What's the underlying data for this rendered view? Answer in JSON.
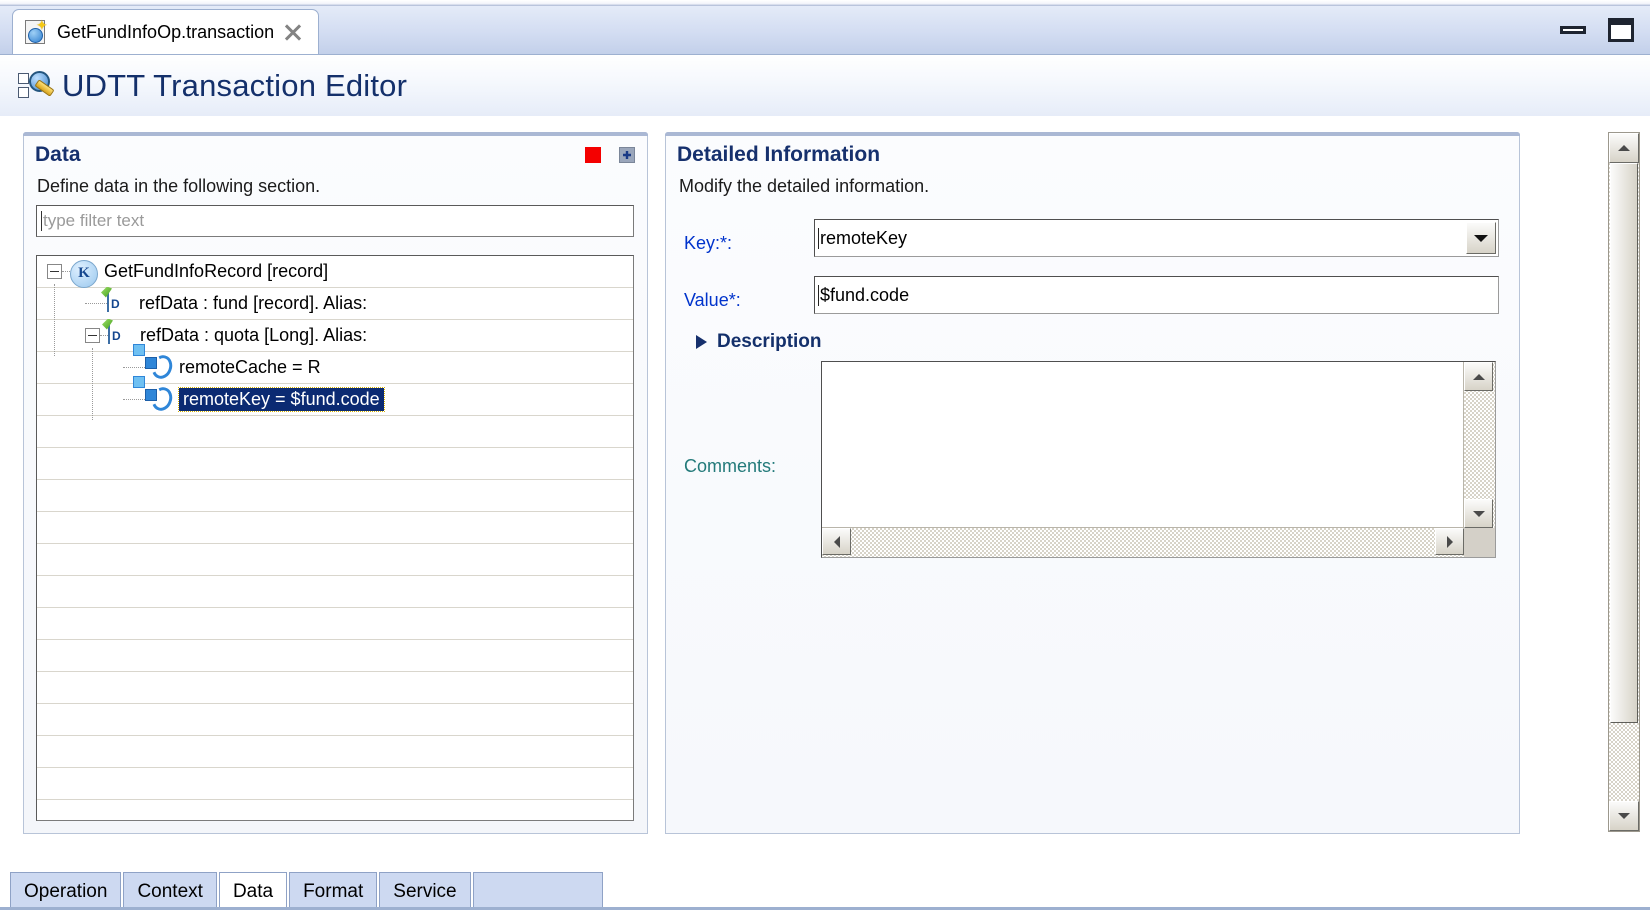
{
  "window": {
    "tab_title": "GetFundInfoOp.transaction",
    "tab_icon": "transaction-file-icon",
    "close_icon": "close-icon",
    "minimize_icon": "minimize-icon",
    "maximize_icon": "maximize-icon"
  },
  "form": {
    "title": "UDTT Transaction Editor",
    "icon": "udtt-editor-icon"
  },
  "data_section": {
    "title": "Data",
    "subtitle": "Define data in the following section.",
    "stop_icon": "stop-icon",
    "restore_icon": "restore-icon",
    "filter": {
      "placeholder": "type filter text",
      "value": ""
    },
    "tree": [
      {
        "label": "GetFundInfoRecord [record]",
        "icon": "record-key-icon",
        "indent": 0,
        "expander": "collapse",
        "selected": false
      },
      {
        "label": "refData : fund [record]. Alias:",
        "icon": "data-element-icon",
        "indent": 1,
        "expander": "none",
        "selected": false
      },
      {
        "label": "refData : quota [Long]. Alias:",
        "icon": "data-element-icon",
        "indent": 1,
        "expander": "collapse",
        "selected": false
      },
      {
        "label": "remoteCache = R",
        "icon": "key-value-icon",
        "indent": 2,
        "expander": "none",
        "selected": false
      },
      {
        "label": "remoteKey = $fund.code",
        "icon": "key-value-icon",
        "indent": 2,
        "expander": "none",
        "selected": true
      }
    ],
    "empty_row_count": 12
  },
  "detail_section": {
    "title": "Detailed Information",
    "subtitle": "Modify the detailed information.",
    "key_label": "Key:*:",
    "key_value": "remoteKey",
    "key_dropdown_icon": "chevron-down-icon",
    "value_label": "Value*:",
    "value_value": "$fund.code",
    "description_label": "Description",
    "description_twisty_icon": "triangle-right-icon",
    "comments_label": "Comments:",
    "comments_value": "",
    "scroll_up_icon": "arrow-up-icon",
    "scroll_down_icon": "arrow-down-icon",
    "scroll_left_icon": "arrow-left-icon",
    "scroll_right_icon": "arrow-right-icon"
  },
  "outer_scrollbar": {
    "up_icon": "arrow-up-icon",
    "down_icon": "arrow-down-icon"
  },
  "bottom_tabs": {
    "items": [
      {
        "label": "Operation",
        "active": false
      },
      {
        "label": "Context",
        "active": false
      },
      {
        "label": "Data",
        "active": true
      },
      {
        "label": "Format",
        "active": false
      },
      {
        "label": "Service",
        "active": false
      }
    ]
  },
  "colors": {
    "title_blue": "#14306b",
    "label_blue": "#0033cc",
    "label_teal": "#237a7a",
    "selection_navy": "#0b2a72",
    "stop_red": "#f40000",
    "tab_blue": "#cdd9f1"
  }
}
